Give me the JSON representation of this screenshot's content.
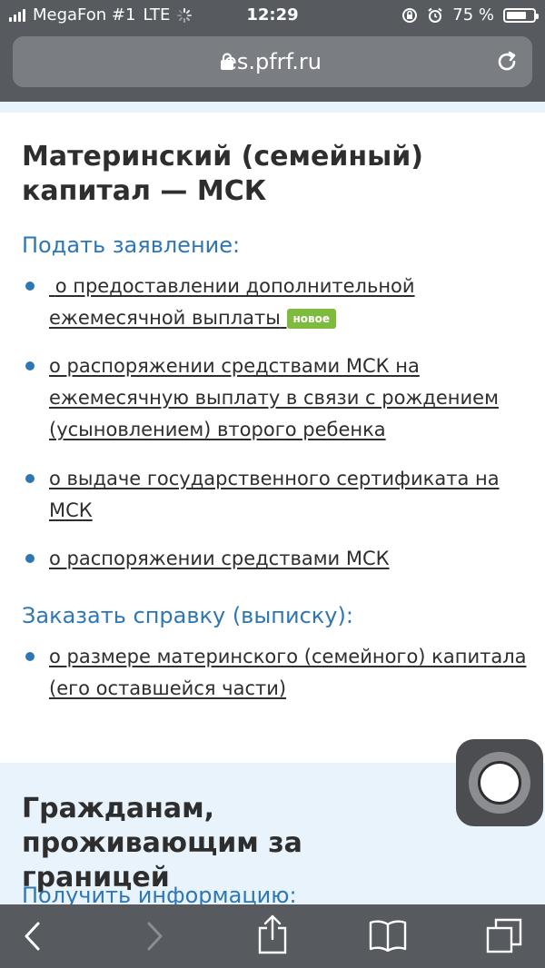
{
  "status_bar": {
    "carrier": "MegaFon #1",
    "network": "LTE",
    "time": "12:29",
    "battery_percent_label": "75 %",
    "battery_level": 0.75
  },
  "browser": {
    "domain": "es.pfrf.ru",
    "icons": {
      "lock": "lock-icon",
      "reload": "reload-icon"
    }
  },
  "section_msk": {
    "title": "Материнский (семейный) капитал — МСК",
    "apply_heading": "Подать заявление:",
    "apply_items": [
      {
        "label": "о предоставлении дополнительной ежемесячной выплаты",
        "badge": "новое"
      },
      {
        "label": "о распоряжении средствами МСК на ежемесячную выплату в связи с рождением (усыновлением) второго ребенка"
      },
      {
        "label": "о выдаче государственного сертификата на МСК"
      },
      {
        "label": "о распоряжении средствами МСК"
      }
    ],
    "certificate_heading": "Заказать справку (выписку):",
    "certificate_items": [
      {
        "label": "о размере материнского (семейного) капитала (его оставшейся части)"
      }
    ]
  },
  "section_abroad": {
    "title": "Гражданам, проживающим за границей",
    "info_heading": "Получить информацию:"
  },
  "toolbar": {
    "icons": [
      "back-icon",
      "forward-icon",
      "share-icon",
      "bookmarks-icon",
      "tabs-icon"
    ]
  },
  "colors": {
    "accent": "#2f77b3",
    "badge": "#7dba3d",
    "chrome": "#575b60"
  }
}
